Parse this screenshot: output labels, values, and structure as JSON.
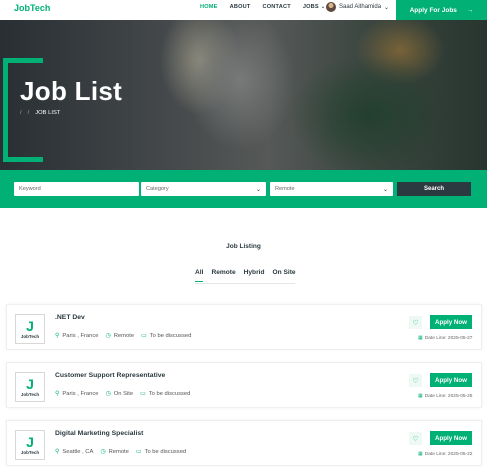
{
  "nav": {
    "brand": "JobTech",
    "links": [
      "HOME",
      "ABOUT",
      "CONTACT",
      "JOBS"
    ],
    "user_name": "Saad Aithamida",
    "apply_label": "Apply For Jobs",
    "accent": "#00b074"
  },
  "hero": {
    "title": "Job List",
    "breadcrumb_current": "JOB LIST"
  },
  "search": {
    "keyword_placeholder": "Keyword",
    "category_value": "Category",
    "remote_value": "Remote",
    "button_label": "Search"
  },
  "listing": {
    "heading": "Job Listing",
    "tabs": [
      "All",
      "Remote",
      "Hybrid",
      "On Site"
    ],
    "jobs": [
      {
        "logo_letter": "J",
        "logo_text": "JobTech",
        "title": ".NET Dev",
        "location": "Paris , France",
        "mode": "Remote",
        "salary": "To be discussed",
        "apply_label": "Apply Now",
        "deadline": "Date Line: 2025-05-27"
      },
      {
        "logo_letter": "J",
        "logo_text": "JobTech",
        "title": "Customer Support Representative",
        "location": "Paris , France",
        "mode": "On Site",
        "salary": "To be discussed",
        "apply_label": "Apply Now",
        "deadline": "Date Line: 2025-05-25"
      },
      {
        "logo_letter": "J",
        "logo_text": "JobTech",
        "title": "Digital Marketing Specialist",
        "location": "Seattle , CA",
        "mode": "Remote",
        "salary": "To be discussed",
        "apply_label": "Apply Now",
        "deadline": "Date Line: 2025-05-22"
      }
    ]
  }
}
